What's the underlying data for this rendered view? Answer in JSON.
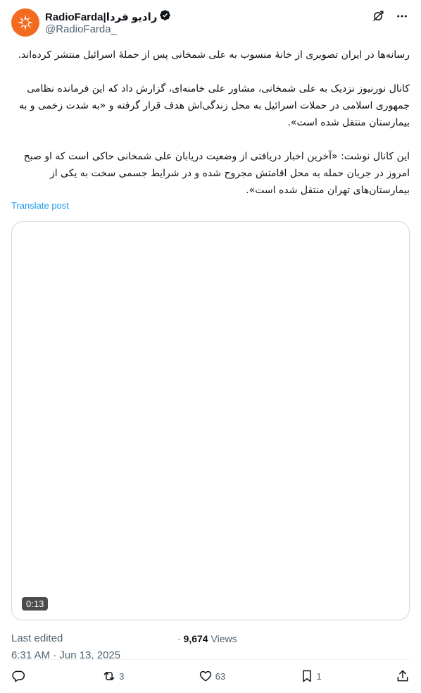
{
  "account": {
    "display_name": "RadioFarda|رادیو فردا",
    "handle": "@RadioFarda_"
  },
  "post": {
    "paragraphs": [
      "رسانه‌ها در ایران تصویری از خانهٔ منسوب به علی شمخانی پس از حملهٔ اسرائیل منتشر کرده‌اند.",
      "کانال نورنیوز نزدیک به علی شمخانی، مشاور علی خامنه‌ای، گزارش داد که این فرمانده نظامی جمهوری اسلامی در حملات اسرائیل به محل زندگی‌اش هدف قرار گرفته و «به شدت زخمی و به بیمارستان منتقل شده است».",
      "این کانال نوشت: «آخرین اخبار دریافتی از وضعیت دریابان علی شمخانی حاکی است که او صبح امروز در جریان حمله به محل اقامتش مجروح شده و در شرایط جسمی سخت به یکی از بیمارستان‌های تهران منتقل شده است»."
    ],
    "translate_label": "Translate post"
  },
  "media": {
    "duration": "0:13"
  },
  "meta": {
    "edited_label": "Last edited",
    "timestamp": "6:31 AM · Jun 13, 2025",
    "separator": "·",
    "views_count": "9,674",
    "views_label": "Views"
  },
  "actions": {
    "reply_count": "",
    "repost_count": "3",
    "like_count": "63",
    "bookmark_count": "1"
  },
  "colors": {
    "accent": "#1d9bf0",
    "brand": "#f26b21",
    "verified": "#0f1419",
    "muted": "#536471"
  }
}
